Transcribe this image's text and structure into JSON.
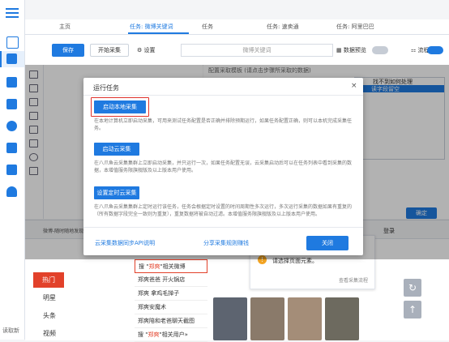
{
  "tabs": [
    "主页",
    "任务: 微博关键词",
    "任务",
    "任务: 速卖通",
    "任务: 阿里巴巴"
  ],
  "toolbar": {
    "save_label": "保存",
    "start_label": "开始采集",
    "settings_label": "设置",
    "task_name_placeholder": "微博关键词",
    "preview_label": "数据预览",
    "flow_label": "流程"
  },
  "config": {
    "title": "配置采取模板 (请点击步骤所采取的数据)",
    "table_header": "找不到如何处理",
    "table_row": "读字段留空",
    "ok_label": "确定"
  },
  "sidebar": {
    "bottom_label": "读取新"
  },
  "browser": {
    "address": "微博-随时随地发现新鲜事",
    "hot_label": "热门",
    "categories": [
      "明星",
      "头条",
      "视频"
    ],
    "suggestions": [
      {
        "prefix": "搜 \"",
        "keyword": "郑爽",
        "suffix": "\"相关微博"
      },
      {
        "prefix": "",
        "keyword": "",
        "suffix": "郑爽爸爸 开火锅店"
      },
      {
        "prefix": "",
        "keyword": "",
        "suffix": "郑爽 拿鸡毛掸子"
      },
      {
        "prefix": "",
        "keyword": "",
        "suffix": "郑爽安魔术"
      },
      {
        "prefix": "",
        "keyword": "",
        "suffix": "郑爽陪和老爸聊天截图"
      },
      {
        "prefix": "搜 \"",
        "keyword": "郑爽",
        "suffix": "\"相关用户»"
      }
    ],
    "login_label": "登录",
    "tip_text": "请选择页面元素。",
    "tip_link": "查看采集流程"
  },
  "modal": {
    "title": "运行任务",
    "close_icon": "×",
    "local_button": "启动本地采集",
    "local_desc": "在本地计算机立即启动采集，可用来测试任务配置是否正确并排除预期运行，如果任务配置正确，则可以本机完成采集任务。",
    "cloud_button": "启动云采集",
    "cloud_desc": "在八爪鱼云采集集群上立即启动采集，并只运行一次，如果任务配置无误，云采集启动后可以在任务列表中看到采集的数据，本增值服务限旗舰版及以上版本用户使用。",
    "schedule_button": "设置定时云采集",
    "schedule_desc": "在八爪鱼云采集集群上定时运行该任务，任务会根据定时设置的时间周期性多次运行，多次运行采集的数据如果有重复的（所有数据字段完全一致则为重复），重复数据将被自动过滤。本增值服务限旗舰版及以上版本用户使用。",
    "api_link": "云采集数据同步API说明",
    "share_link": "分享采集规则赚钱",
    "close_button": "关闭"
  }
}
